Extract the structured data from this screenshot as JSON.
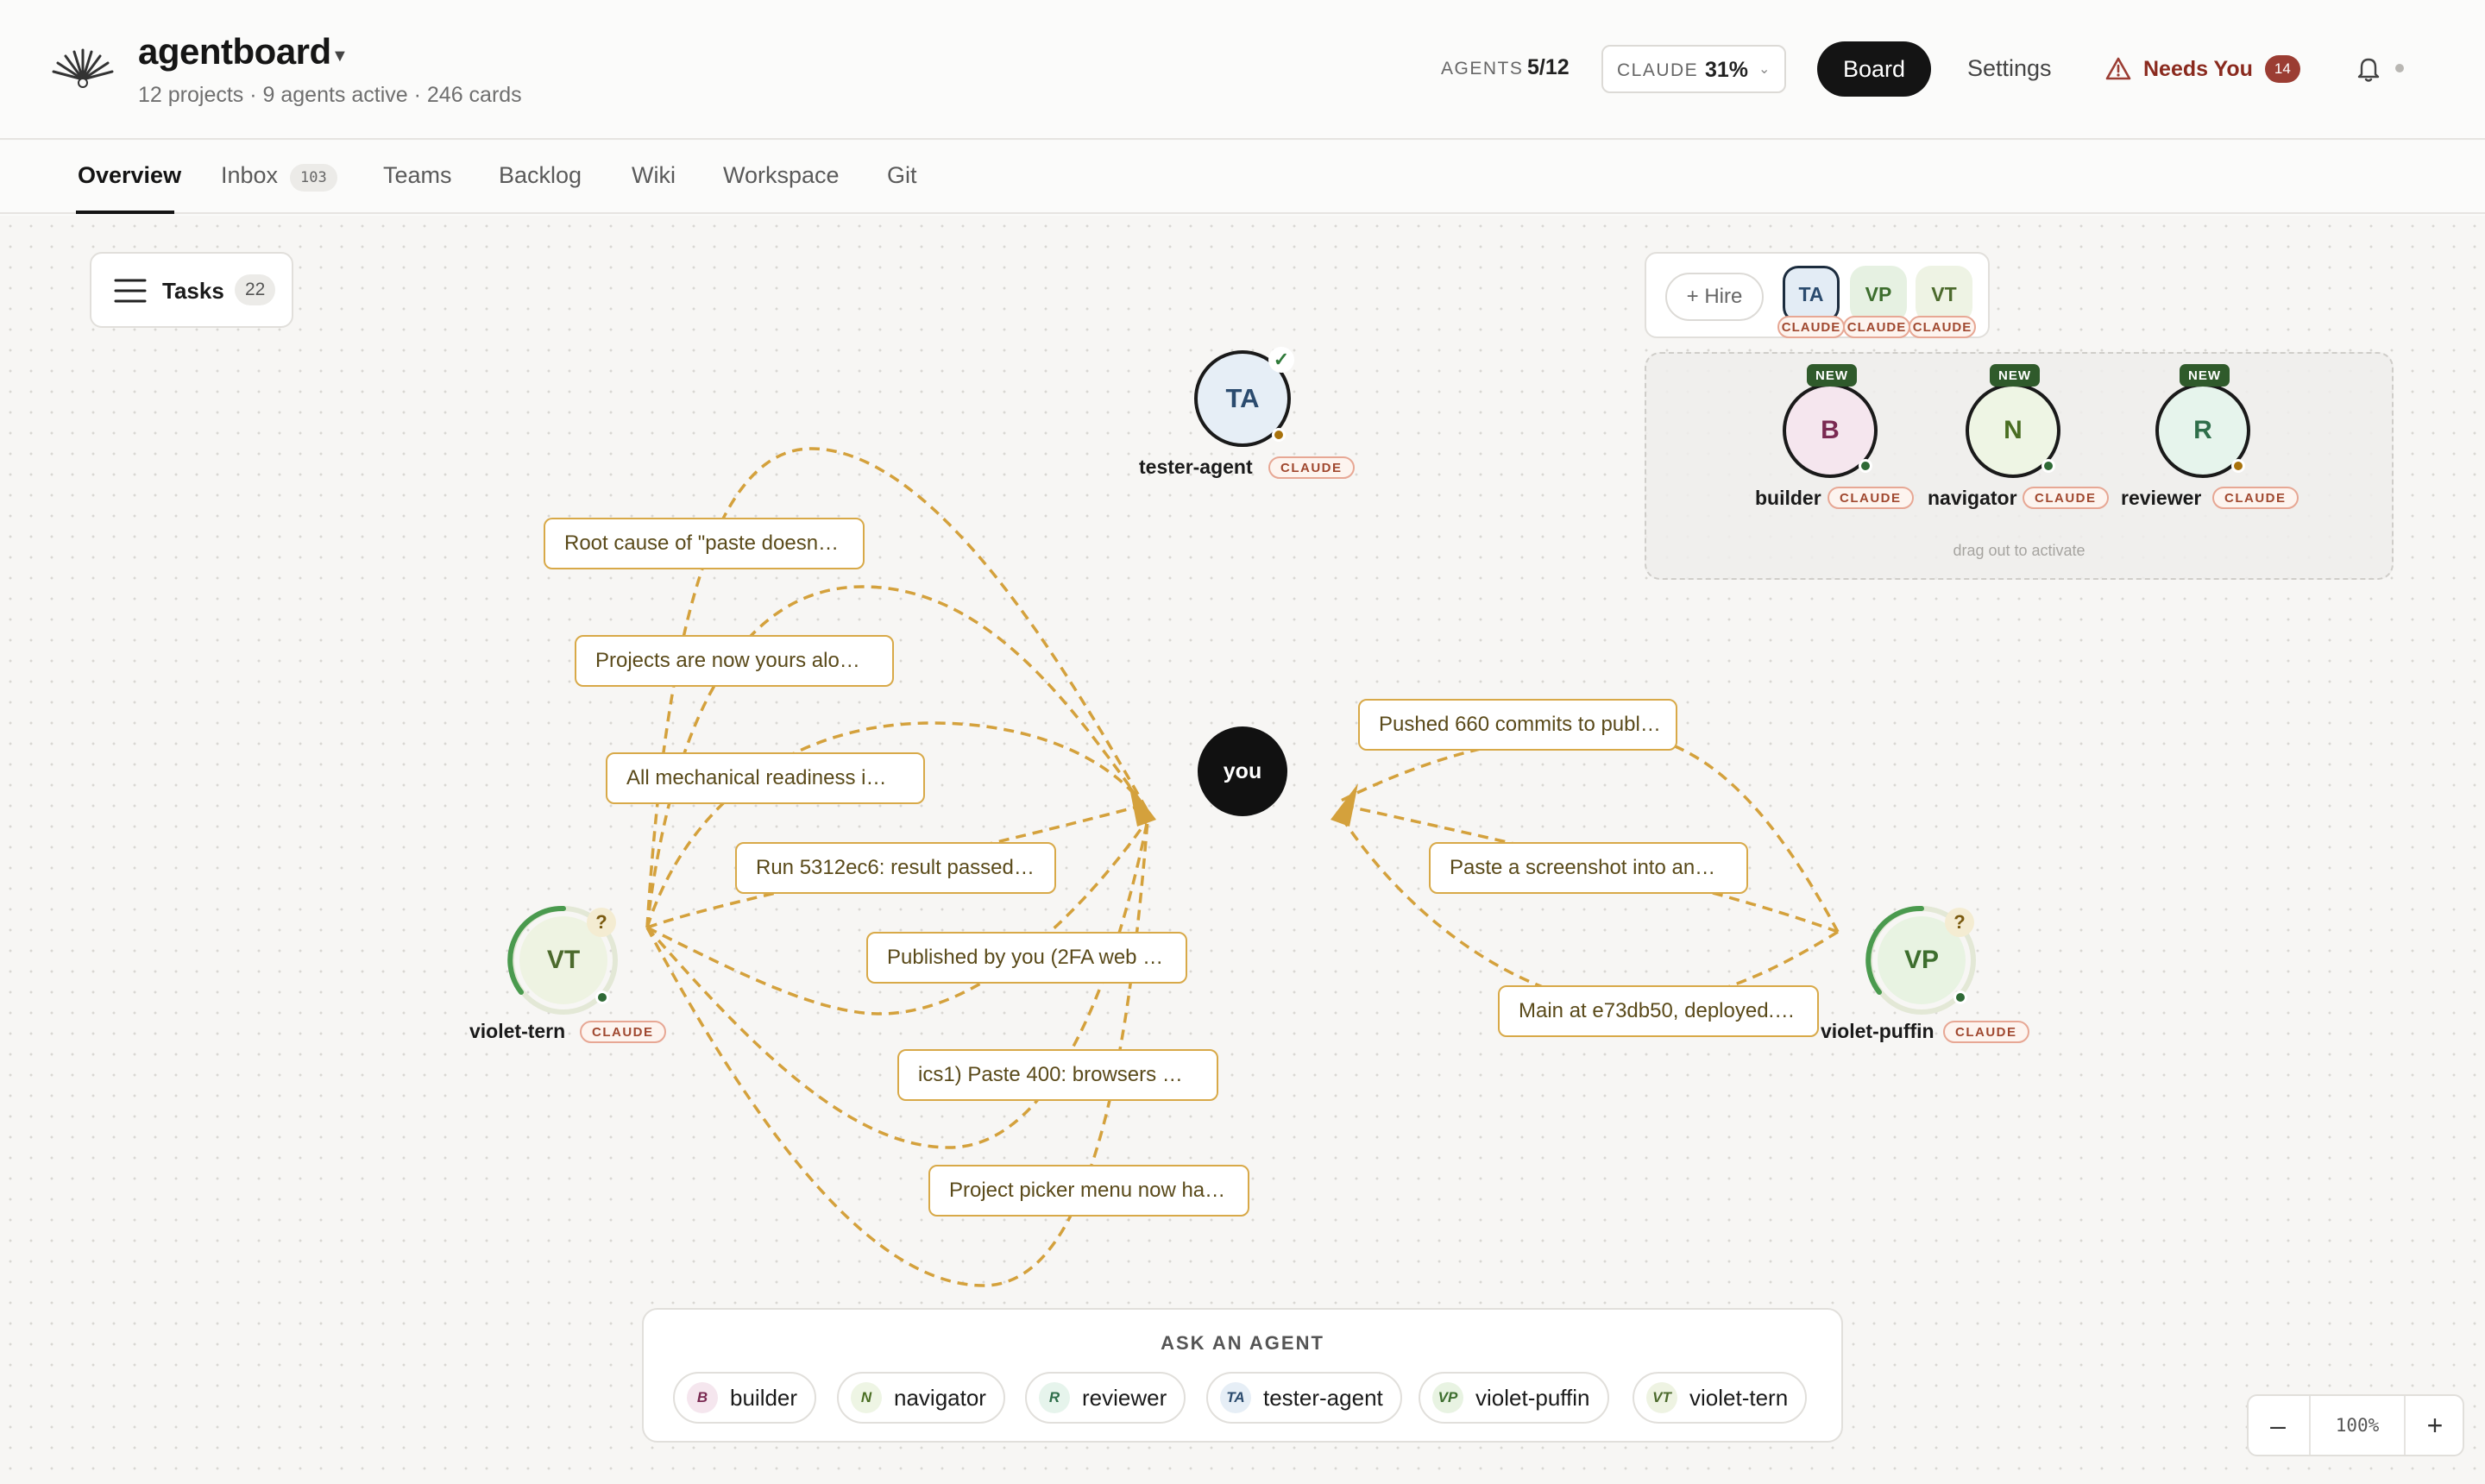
{
  "header": {
    "app_title": "agentboard",
    "subtitle": "12 projects · 9 agents active · 246 cards",
    "agents_label": "AGENTS",
    "agents_value": "5/12",
    "claude_label": "CLAUDE",
    "claude_value": "31%",
    "board_label": "Board",
    "settings_label": "Settings",
    "needs_you_label": "Needs You",
    "needs_you_count": "14"
  },
  "tabs": [
    {
      "label": "Overview"
    },
    {
      "label": "Inbox",
      "badge": "103"
    },
    {
      "label": "Teams"
    },
    {
      "label": "Backlog"
    },
    {
      "label": "Wiki"
    },
    {
      "label": "Workspace"
    },
    {
      "label": "Git"
    }
  ],
  "tasks": {
    "label": "Tasks",
    "count": "22"
  },
  "hire": {
    "label": "+ Hire",
    "chips": [
      {
        "initials": "TA",
        "tag": "CLAUDE"
      },
      {
        "initials": "VP",
        "tag": "CLAUDE"
      },
      {
        "initials": "VT",
        "tag": "CLAUDE"
      }
    ]
  },
  "bench": {
    "hint": "drag out to activate",
    "agents": [
      {
        "initials": "B",
        "name": "builder",
        "new_tag": "NEW",
        "tag": "CLAUDE"
      },
      {
        "initials": "N",
        "name": "navigator",
        "new_tag": "NEW",
        "tag": "CLAUDE"
      },
      {
        "initials": "R",
        "name": "reviewer",
        "new_tag": "NEW",
        "tag": "CLAUDE"
      }
    ]
  },
  "graph": {
    "you_label": "you",
    "agents": [
      {
        "initials": "TA",
        "name": "tester-agent",
        "tag": "CLAUDE",
        "badge": "✓"
      },
      {
        "initials": "VT",
        "name": "violet-tern",
        "tag": "CLAUDE",
        "badge": "?"
      },
      {
        "initials": "VP",
        "name": "violet-puffin",
        "tag": "CLAUDE",
        "badge": "?"
      }
    ],
    "cards_left": [
      "Root cause of \"paste doesn…",
      "Projects are now yours alo…",
      "All mechanical readiness i…",
      "Run 5312ec6: result passed…",
      "Published by you (2FA web …",
      "ics1) Paste 400: browsers …",
      "Project picker menu now ha…"
    ],
    "cards_right": [
      "Pushed 660 commits to publ…",
      "Paste a screenshot into an…",
      "Main at e73db50, deployed.…"
    ]
  },
  "ask": {
    "title": "ASK AN AGENT",
    "agents": [
      {
        "initials": "B",
        "name": "builder"
      },
      {
        "initials": "N",
        "name": "navigator"
      },
      {
        "initials": "R",
        "name": "reviewer"
      },
      {
        "initials": "TA",
        "name": "tester-agent"
      },
      {
        "initials": "VP",
        "name": "violet-puffin"
      },
      {
        "initials": "VT",
        "name": "violet-tern"
      }
    ]
  },
  "zoom": {
    "minus": "–",
    "value": "100%",
    "plus": "+"
  },
  "colors": {
    "edge": "#d4a13c",
    "accent_dark": "#141414",
    "claude_tag": "#a0482f",
    "alert": "#8a2a1e"
  }
}
